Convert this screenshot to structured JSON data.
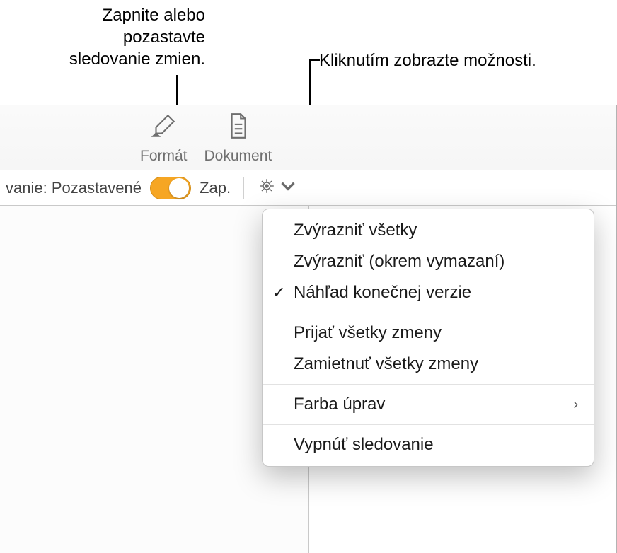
{
  "callouts": {
    "toggle_hint_l1": "Zapnite alebo",
    "toggle_hint_l2": "pozastavte",
    "toggle_hint_l3": "sledovanie zmien.",
    "options_hint": "Kliknutím zobrazte možnosti."
  },
  "toolbar": {
    "format_label": "Formát",
    "document_label": "Dokument"
  },
  "trackbar": {
    "status_text": "vanie: Pozastavené",
    "on_label": "Zap."
  },
  "menu": {
    "highlight_all": "Zvýrazniť všetky",
    "highlight_except_deletions": "Zvýrazniť (okrem vymazaní)",
    "preview_final": "Náhľad konečnej verzie",
    "accept_all": "Prijať všetky zmeny",
    "reject_all": "Zamietnuť všetky zmeny",
    "edit_color": "Farba úprav",
    "turn_off_tracking": "Vypnúť sledovanie"
  },
  "colors": {
    "toggle_on": "#f6a623"
  }
}
